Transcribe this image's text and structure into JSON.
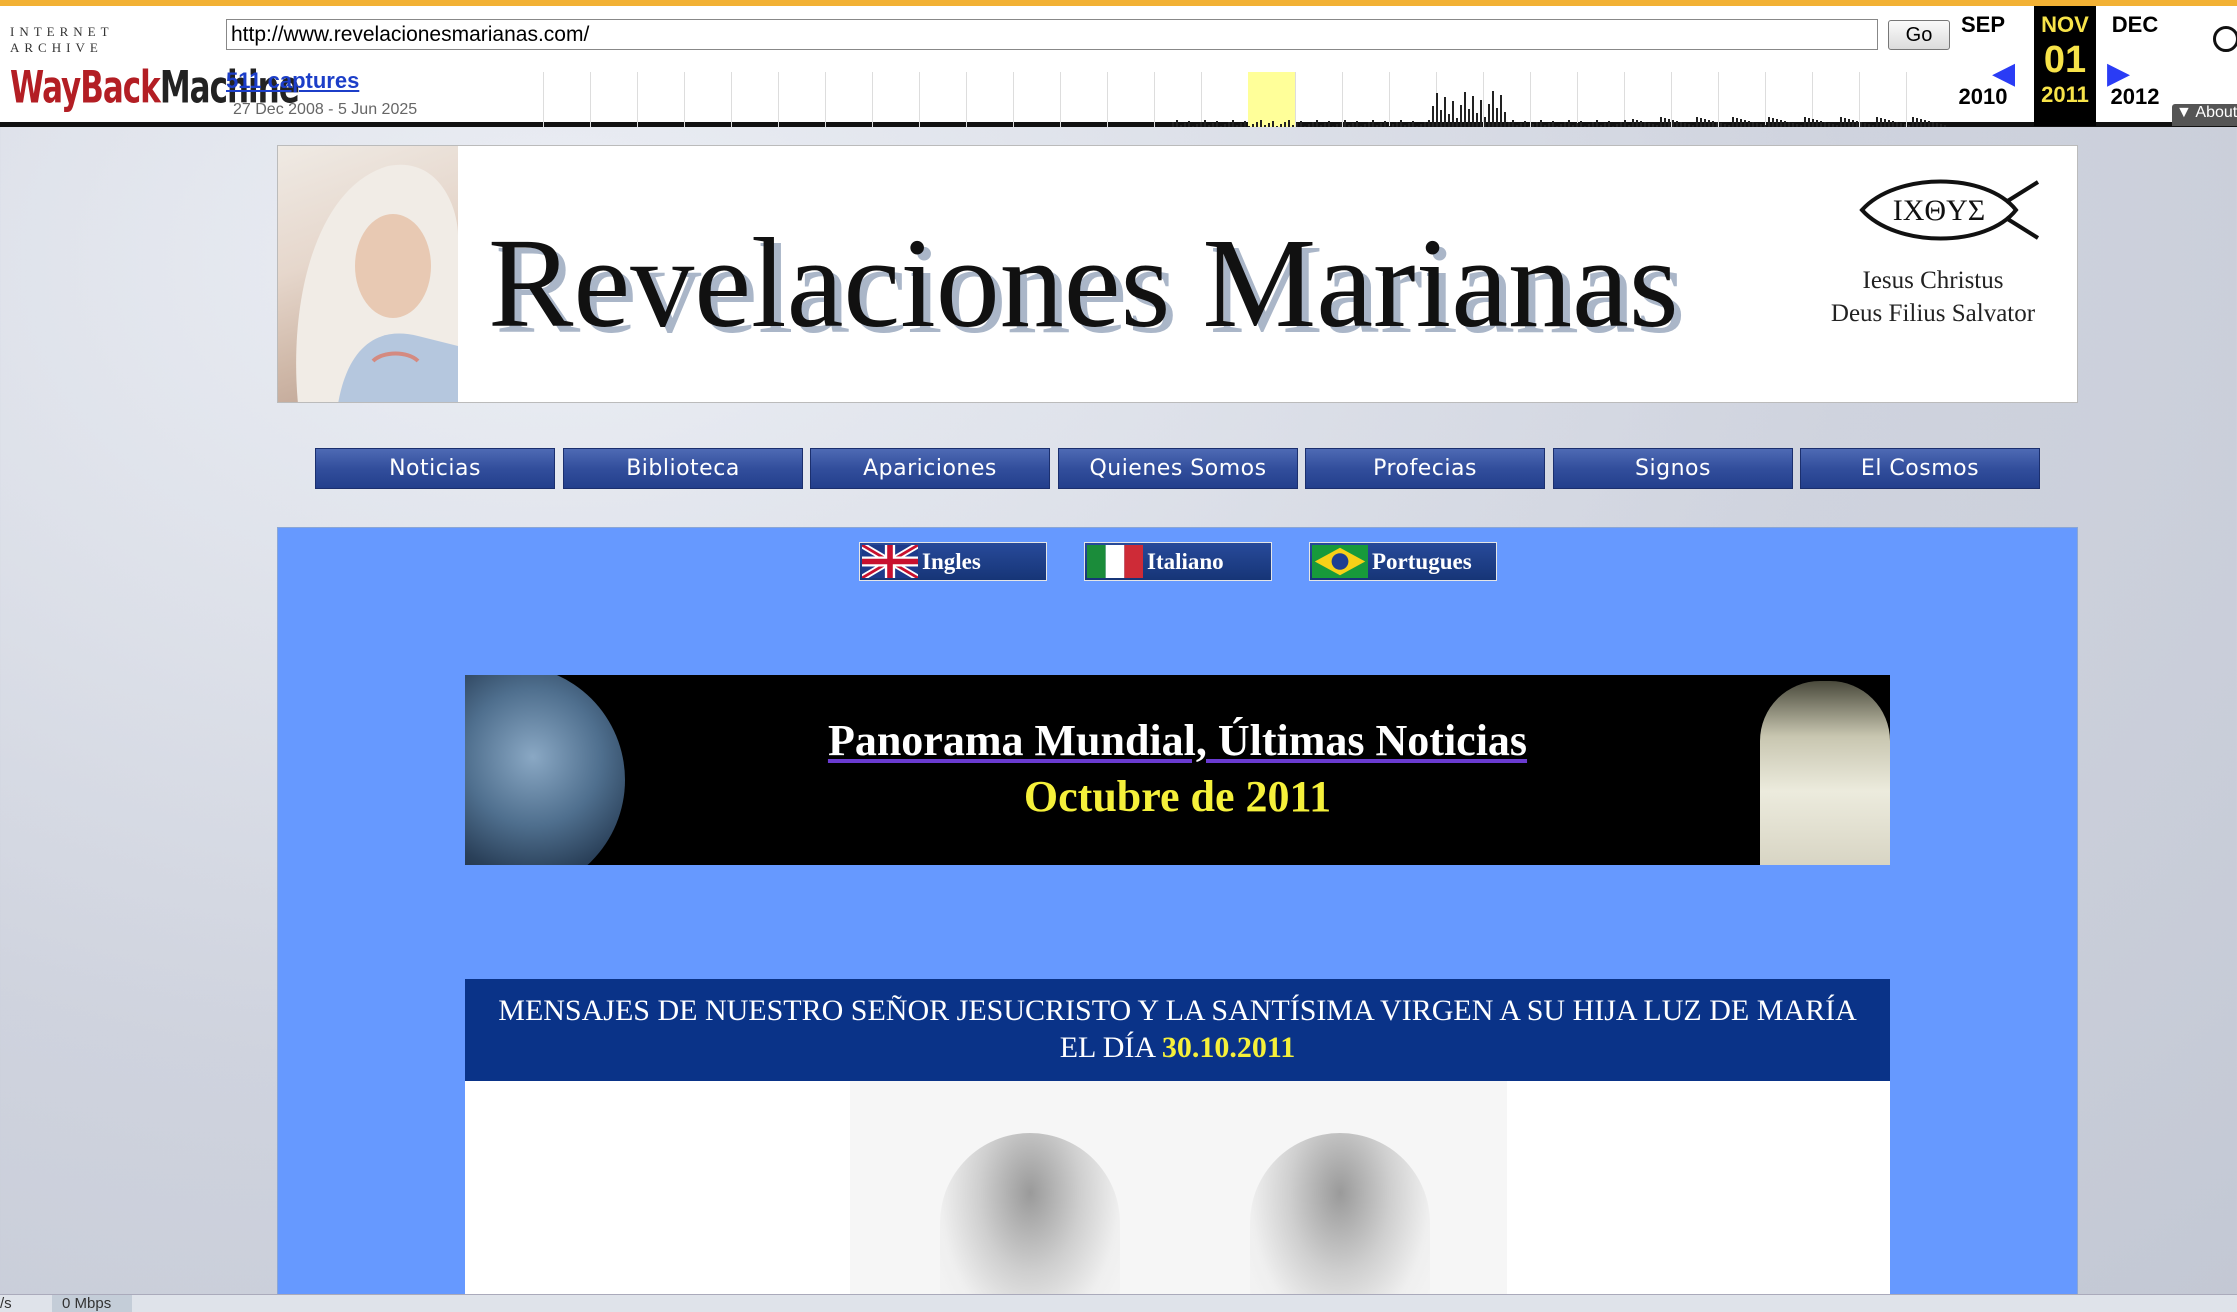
{
  "wayback": {
    "logo_top": "INTERNET ARCHIVE",
    "logo_wayback": "WayBack",
    "logo_machine": "Machine",
    "url": "http://www.revelacionesmarianas.com/",
    "go_label": "Go",
    "captures": "511 captures",
    "date_range": "27 Dec 2008 - 5 Jun 2025",
    "prev": {
      "month": "SEP",
      "year": "2010"
    },
    "current": {
      "month": "NOV",
      "day": "01",
      "year": "2011"
    },
    "next": {
      "month": "DEC",
      "year": "2012"
    },
    "about_label": "▼ About"
  },
  "header": {
    "title": "Revelaciones Marianas",
    "ichthys": "IΧΘYΣ",
    "motto_line1": "Iesus Christus",
    "motto_line2": "Deus Filius Salvator"
  },
  "nav": {
    "items": [
      "Noticias",
      "Biblioteca",
      "Apariciones",
      "Quienes Somos",
      "Profecias",
      "Signos",
      "El Cosmos"
    ]
  },
  "languages": [
    "Ingles",
    "Italiano",
    "Portugues"
  ],
  "banner": {
    "title": "Panorama Mundial, Últimas Noticias",
    "date": "Octubre de 2011"
  },
  "message": {
    "heading_line1": "MENSAJES DE NUESTRO SEÑOR JESUCRISTO Y LA SANTÍSIMA VIRGEN A SU HIJA LUZ DE MARÍA",
    "heading_line2_prefix": "EL DÍA",
    "date": "30.10.2011"
  },
  "status": {
    "speed_a": "/s",
    "speed_b": "0 Mbps"
  },
  "colors": {
    "content_bg": "#6699ff",
    "nav_bg": "#324e9c",
    "banner_date": "#f5f03a",
    "message_head_bg": "#0a3388"
  }
}
